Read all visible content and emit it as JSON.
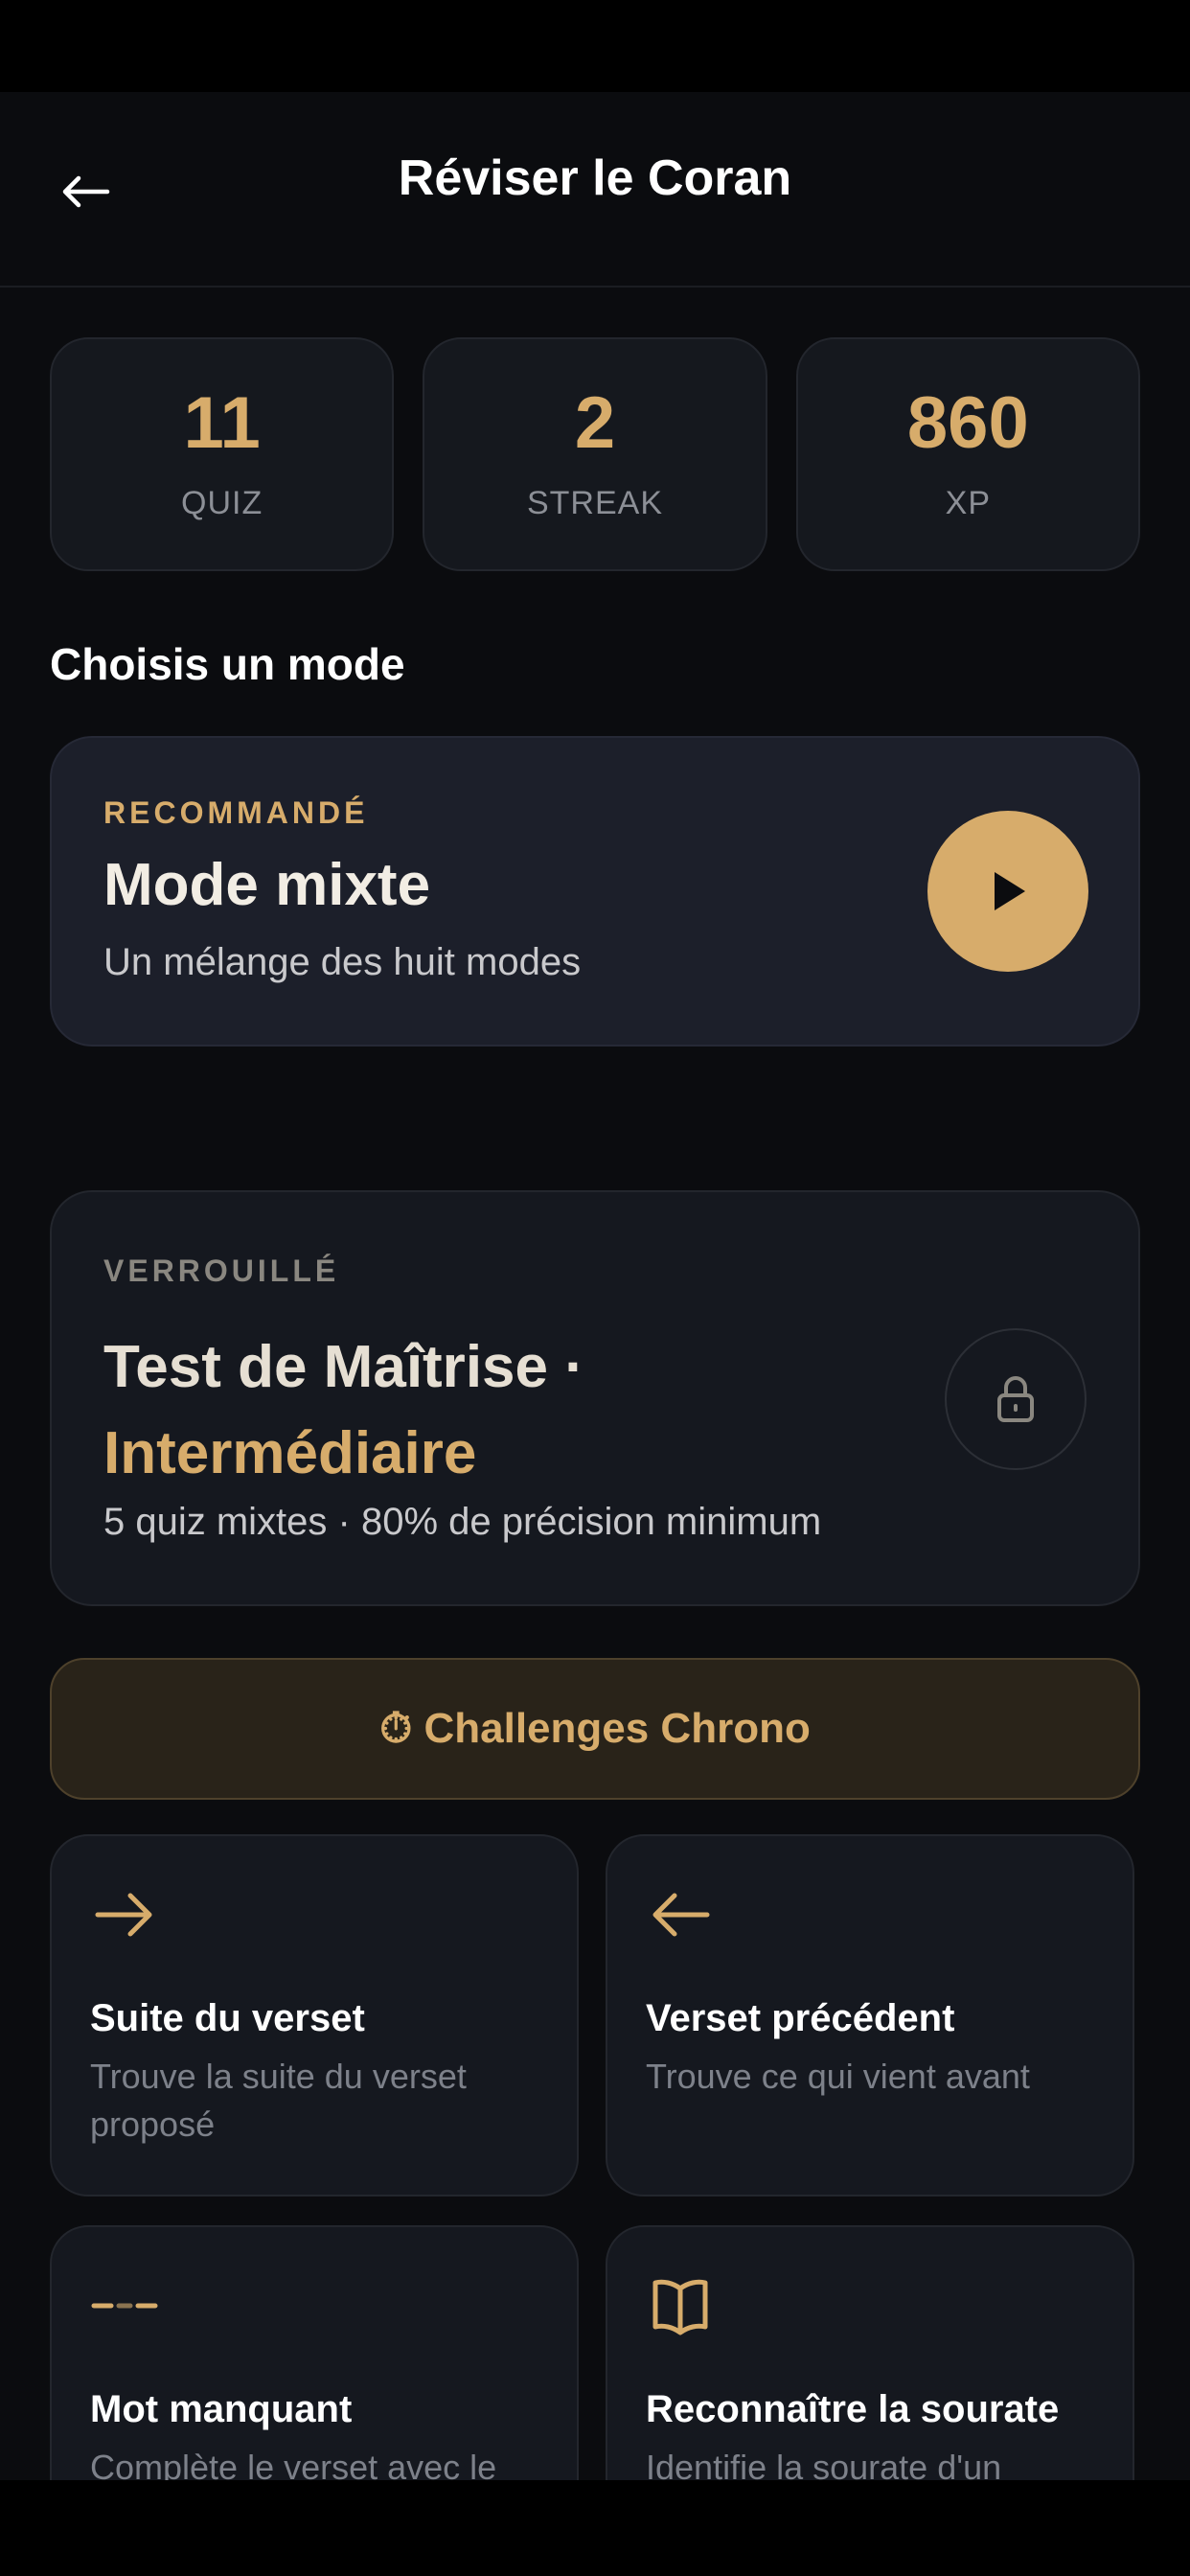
{
  "header": {
    "title": "Réviser le Coran",
    "back_glyph": "←"
  },
  "stats": [
    {
      "value": "11",
      "label": "QUIZ"
    },
    {
      "value": "2",
      "label": "STREAK"
    },
    {
      "value": "860",
      "label": "XP"
    }
  ],
  "section_title": "Choisis un mode",
  "recommended": {
    "eyebrow": "RECOMMANDÉ",
    "title": "Mode mixte",
    "subtitle": "Un mélange des huit modes"
  },
  "locked": {
    "eyebrow": "VERROUILLÉ",
    "title_part1": "Test de Maîtrise ·",
    "title_part2": "Intermédiaire",
    "subtitle": "5 quiz mixtes · 80% de précision minimum"
  },
  "chrono": {
    "icon": "⏱",
    "label": "Challenges Chrono"
  },
  "modes": [
    {
      "icon": "arrow-right-icon",
      "title": "Suite du verset",
      "desc": "Trouve la suite du verset proposé"
    },
    {
      "icon": "arrow-left-icon",
      "title": "Verset précédent",
      "desc": "Trouve ce qui vient avant"
    },
    {
      "icon": "dashes-icon",
      "title": "Mot manquant",
      "desc": "Complète le verset avec le bon mot"
    },
    {
      "icon": "book-open-icon",
      "title": "Reconnaître la sourate",
      "desc": "Identifie la sourate d'un verset"
    }
  ],
  "colors": {
    "accent": "#d7ac6b",
    "background": "#0b0c0f",
    "card": "#15181f",
    "card_highlight": "#1c1f2a",
    "chrono_bg": "#292319"
  }
}
